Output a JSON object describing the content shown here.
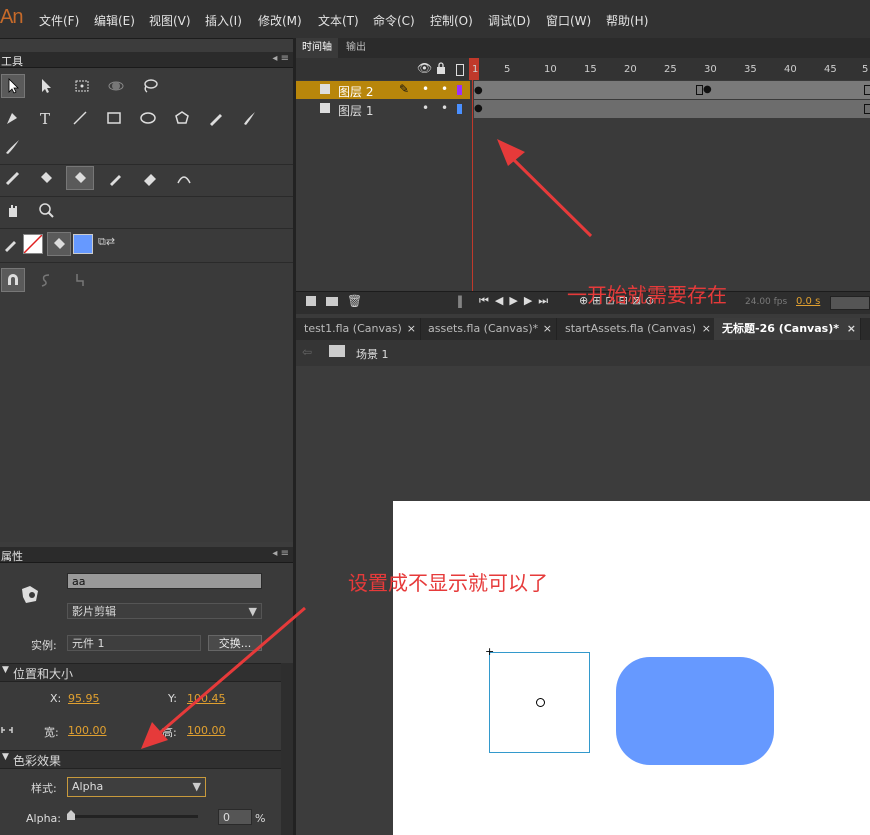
{
  "app": {
    "logo": "An"
  },
  "menu": [
    "文件(F)",
    "编辑(E)",
    "视图(V)",
    "插入(I)",
    "修改(M)",
    "文本(T)",
    "命令(C)",
    "控制(O)",
    "调试(D)",
    "窗口(W)",
    "帮助(H)"
  ],
  "tools_panel": {
    "title": "工具"
  },
  "timeline": {
    "tabs": [
      "时间轴",
      "输出"
    ],
    "ruler": [
      "1",
      "5",
      "10",
      "15",
      "20",
      "25",
      "30",
      "35",
      "40",
      "45",
      "5"
    ],
    "layers": [
      {
        "name": "图层 2"
      },
      {
        "name": "图层 1"
      }
    ],
    "fps": "24.00 fps",
    "time": "0.0 s"
  },
  "doc_tabs": [
    {
      "label": "test1.fla (Canvas)"
    },
    {
      "label": "assets.fla (Canvas)*"
    },
    {
      "label": "startAssets.fla (Canvas)"
    },
    {
      "label": "无标题-26 (Canvas)*"
    }
  ],
  "scene": {
    "label": "场景 1"
  },
  "properties": {
    "title": "属性",
    "instance_name": "aa",
    "type_value": "影片剪辑",
    "instance_label": "实例:",
    "instance_value": "元件 1",
    "swap_button": "交换...",
    "pos_section": "位置和大小",
    "x_label": "X:",
    "x_value": "95.95",
    "y_label": "Y:",
    "y_value": "100.45",
    "w_label": "宽:",
    "w_value": "100.00",
    "h_label": "高:",
    "h_value": "100.00",
    "color_section": "色彩效果",
    "style_label": "样式:",
    "style_value": "Alpha",
    "alpha_label": "Alpha:",
    "alpha_value": "0",
    "alpha_unit": "%"
  },
  "annotations": {
    "timeline_note": "一开始就需要存在",
    "props_note": "设置成不显示就可以了"
  },
  "colors": {
    "accent_orange": "#e0a030",
    "annotation_red": "#e63a3a",
    "rounded_rect_fill": "#6699ff",
    "layer2_highlight": "#b8860b"
  }
}
